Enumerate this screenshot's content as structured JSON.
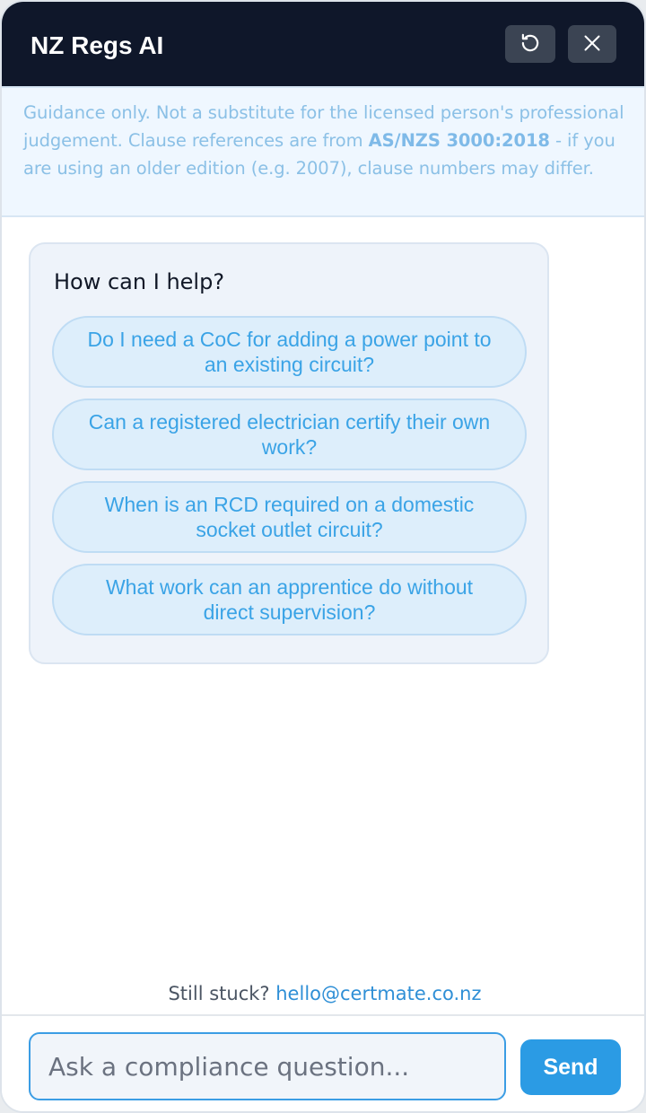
{
  "header": {
    "title": "NZ Regs AI",
    "refresh_icon": "refresh-icon",
    "close_icon": "close-icon"
  },
  "notice": {
    "text_before": "Guidance only. Not a substitute for the licensed person's professional judgement. Clause references are from ",
    "standard": "AS/NZS 3000:2018",
    "text_after": " - if you are using an older edition (e.g. 2007), clause numbers may differ."
  },
  "card": {
    "title": "How can I help?",
    "suggestions": [
      "Do I need a CoC for adding a power point to an existing circuit?",
      "Can a registered electrician certify their own work?",
      "When is an RCD required on a domestic socket outlet circuit?",
      "What work can an apprentice do without direct supervision?"
    ]
  },
  "footer": {
    "stuck_text": "Still stuck?",
    "email": "hello@certmate.co.nz"
  },
  "composer": {
    "placeholder": "Ask a compliance question...",
    "value": "",
    "send_label": "Send"
  },
  "colors": {
    "header_bg": "#0f172a",
    "accent": "#2b9be4",
    "notice_text": "#8bc0e6"
  }
}
